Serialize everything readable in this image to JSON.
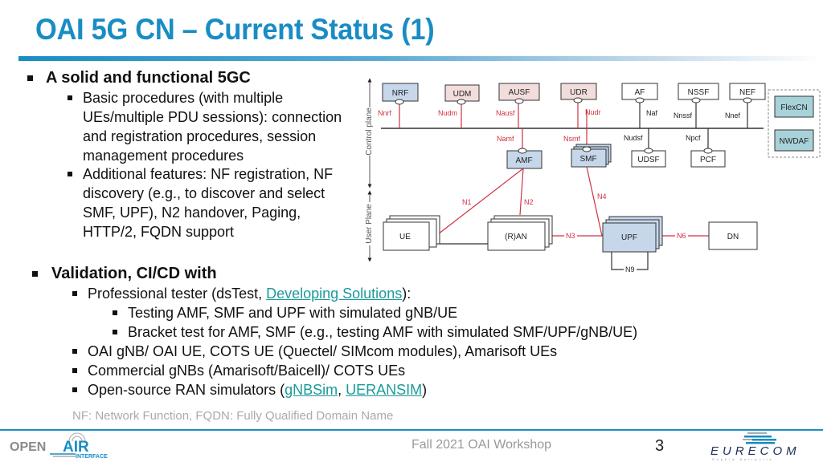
{
  "title": "OAI 5G CN – Current Status (1)",
  "section1": {
    "heading": "A solid and functional 5GC",
    "items": [
      {
        "lines": [
          "Basic procedures (with multiple",
          "UEs/multiple PDU sessions): connection",
          "and registration procedures, session",
          "management procedures"
        ]
      },
      {
        "lines": [
          "Additional features: NF registration, NF",
          "discovery (e.g., to discover and select",
          "SMF, UPF), N2 handover, Paging,",
          "HTTP/2, FQDN support"
        ]
      }
    ]
  },
  "section2": {
    "heading": "Validation, CI/CD with",
    "professional_tester": {
      "prefix": "Professional tester (dsTest, ",
      "link": "Developing Solutions",
      "suffix": "):",
      "subitems": [
        "Testing AMF, SMF and UPF with simulated gNB/UE",
        "Bracket test for AMF, SMF (e.g., testing AMF with simulated SMF/UPF/gNB/UE)"
      ]
    },
    "items": [
      "OAI gNB/ OAI UE, COTS UE (Quectel/ SIMcom modules), Amarisoft UEs",
      "Commercial gNBs (Amarisoft/Baicell)/ COTS UEs"
    ],
    "ran_simulators": {
      "prefix": "Open-source RAN simulators (",
      "link1": "gNBSim",
      "sep": ", ",
      "link2": "UERANSIM",
      "suffix": ")"
    }
  },
  "note": "NF: Network Function, FQDN: Fully Qualified Domain Name",
  "footer": {
    "event": "Fall 2021 OAI Workshop",
    "page": "3",
    "logo_left": {
      "top": "OPEN",
      "air": "AIR",
      "sub": "INTERFACE"
    },
    "logo_right": {
      "name": "EURECOM",
      "tagline": "Sophia Antipolis"
    }
  },
  "diagram": {
    "axis_labels": {
      "control": "Control plane",
      "user": "User Plane"
    },
    "top_nfs": [
      {
        "name": "NRF",
        "iface": "Nnrf",
        "style": "blue"
      },
      {
        "name": "UDM",
        "iface": "Nudm",
        "style": "pink"
      },
      {
        "name": "AUSF",
        "iface": "Nausf",
        "style": "pink"
      },
      {
        "name": "UDR",
        "iface": "Nudr",
        "style": "pink"
      },
      {
        "name": "AF",
        "iface": "Naf",
        "style": "white"
      },
      {
        "name": "NSSF",
        "iface": "Nnssf",
        "style": "white"
      },
      {
        "name": "NEF",
        "iface": "Nnef",
        "style": "white"
      }
    ],
    "bottom_nfs": [
      {
        "name": "AMF",
        "iface": "Namf",
        "style": "blue"
      },
      {
        "name": "SMF",
        "iface": "Nsmf",
        "style": "blue"
      },
      {
        "name": "UDSF",
        "iface": "Nudsf",
        "style": "white"
      },
      {
        "name": "PCF",
        "iface": "Npcf",
        "style": "white"
      }
    ],
    "extra_nfs": [
      "FlexCN",
      "NWDAF"
    ],
    "user_plane": {
      "ue": "UE",
      "ran": "(R)AN",
      "upf": "UPF",
      "dn": "DN"
    },
    "reference_points": {
      "n1": "N1",
      "n2": "N2",
      "n3": "N3",
      "n4": "N4",
      "n6": "N6",
      "n9": "N9"
    },
    "colors": {
      "blue_fill": "#c6d7ea",
      "pink_fill": "#f2dcdc",
      "teal_fill": "#a8d2da",
      "red_line": "#d03040",
      "bus_line": "#555555"
    }
  }
}
